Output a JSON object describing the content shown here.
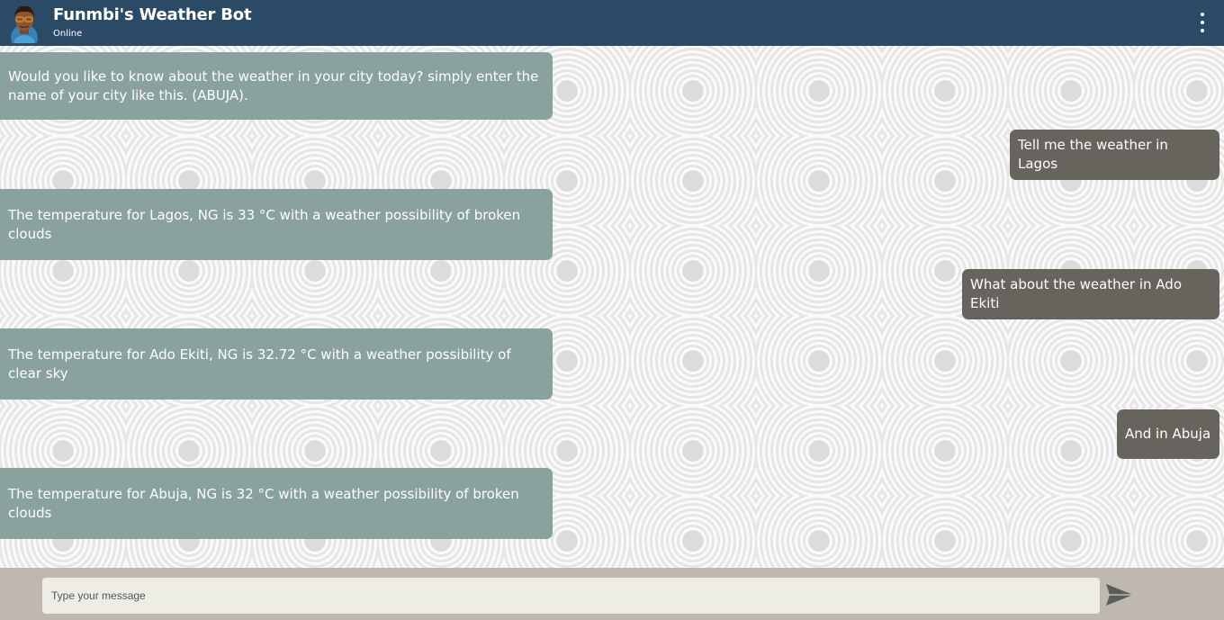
{
  "header": {
    "title": "Funmbi's Weather Bot",
    "status": "Online",
    "avatar_icon": "bot-avatar-icon",
    "menu_icon": "kebab-menu-icon",
    "background_color": "#2b4a66"
  },
  "messages": [
    {
      "sender": "bot",
      "text": "Would you like to know about the weather in your city today? simply enter the name of your city like this. (ABUJA)."
    },
    {
      "sender": "user",
      "text": "Tell me the weather in Lagos"
    },
    {
      "sender": "bot",
      "text": "The temperature for Lagos, NG is 33 °C with a weather possibility of broken clouds"
    },
    {
      "sender": "user",
      "text": "What about the weather in Ado Ekiti"
    },
    {
      "sender": "bot",
      "text": "The temperature for Ado Ekiti, NG is 32.72 °C with a weather possibility of clear sky"
    },
    {
      "sender": "user",
      "text": "And in Abuja"
    },
    {
      "sender": "bot",
      "text": "The temperature for Abuja, NG is 32 °C with a weather possibility of broken clouds"
    }
  ],
  "composer": {
    "placeholder": "Type your message",
    "send_icon": "send-icon"
  },
  "colors": {
    "bot_bubble": "#89a29d",
    "user_bubble": "#66645d",
    "footer": "#bfb8b0"
  }
}
